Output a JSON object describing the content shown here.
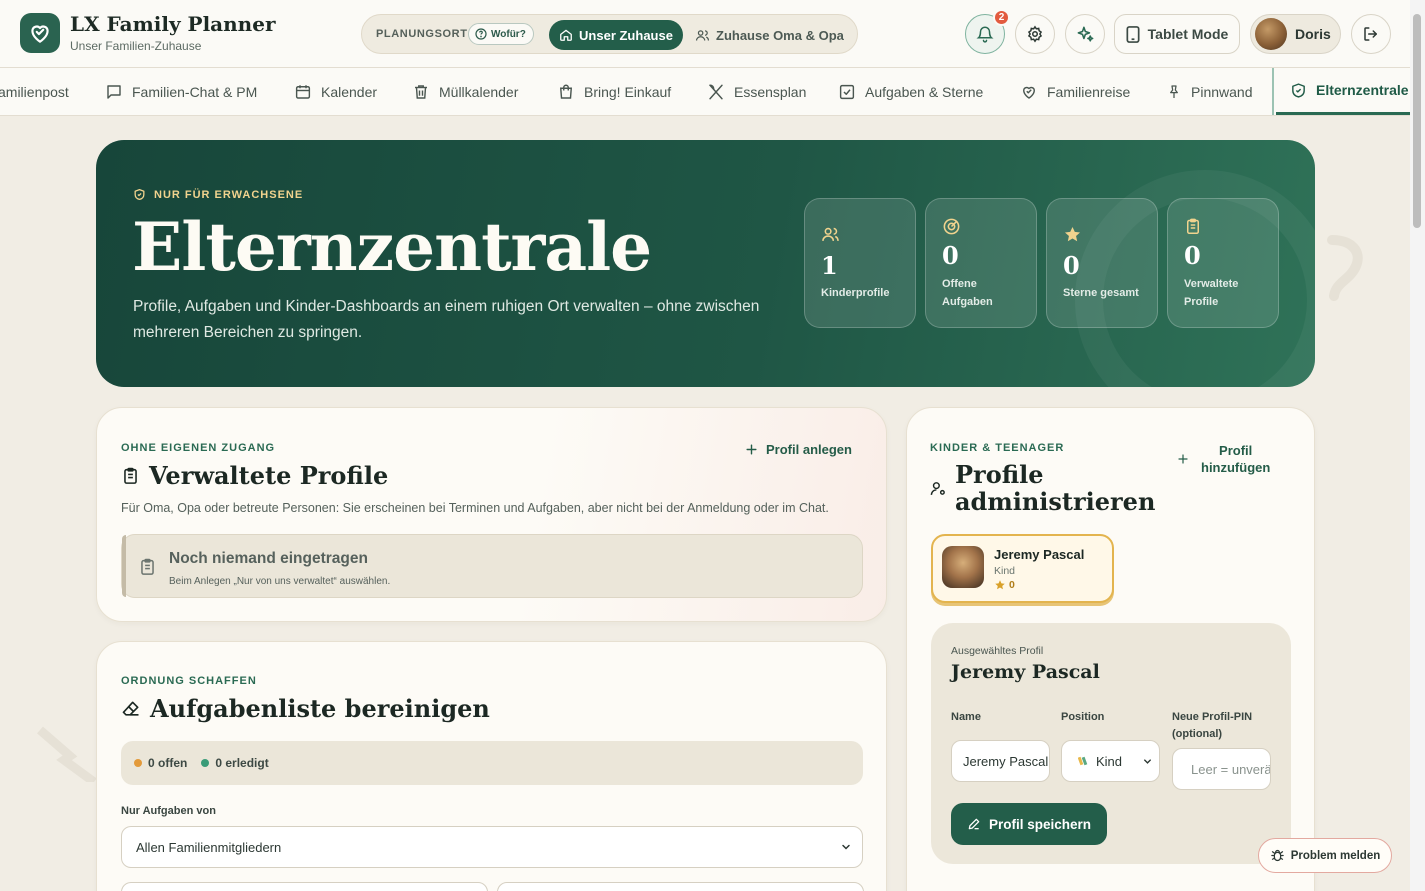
{
  "app": {
    "title": "LX Family Planner",
    "subtitle": "Unser Familien-Zuhause"
  },
  "planning": {
    "label": "PLANUNGSORT",
    "help": "Wofür?",
    "active": "Unser Zuhause",
    "inactive": "Zuhause Oma & Opa"
  },
  "header": {
    "notifications_count": "2",
    "tablet_mode": "Tablet Mode",
    "user_name": "Doris"
  },
  "nav": {
    "tabs": [
      {
        "label": "amilienpost",
        "icon": "mail-icon"
      },
      {
        "label": "Familien-Chat & PM",
        "icon": "chat-icon"
      },
      {
        "label": "Kalender",
        "icon": "calendar-icon"
      },
      {
        "label": "Müllkalender",
        "icon": "trash-icon"
      },
      {
        "label": "Bring! Einkauf",
        "icon": "shopping-bag-icon"
      },
      {
        "label": "Essensplan",
        "icon": "utensils-icon"
      },
      {
        "label": "Aufgaben & Sterne",
        "icon": "checkbox-icon"
      },
      {
        "label": "Familienreise",
        "icon": "heart-icon"
      },
      {
        "label": "Pinnwand",
        "icon": "pin-icon"
      },
      {
        "label": "Elternzentrale",
        "icon": "shield-icon"
      }
    ],
    "active_index": 9
  },
  "hero": {
    "kicker": "NUR FÜR ERWACHSENE",
    "title": "Elternzentrale",
    "description": "Profile, Aufgaben und Kinder-Dashboards an einem ruhigen Ort verwalten – ohne zwischen mehreren Bereichen zu springen.",
    "stats": [
      {
        "value": "1",
        "label": "Kinderprofile",
        "icon": "users-icon"
      },
      {
        "value": "0",
        "label": "Offene Aufgaben",
        "icon": "target-icon"
      },
      {
        "value": "0",
        "label": "Sterne gesamt",
        "icon": "star-icon"
      },
      {
        "value": "0",
        "label": "Verwaltete Profile",
        "icon": "clipboard-icon"
      }
    ]
  },
  "managed": {
    "kicker": "OHNE EIGENEN ZUGANG",
    "title": "Verwaltete Profile",
    "add_link": "Profil anlegen",
    "description": "Für Oma, Opa oder betreute Personen: Sie erscheinen bei Terminen und Aufgaben, aber nicht bei der Anmeldung oder im Chat.",
    "empty_title": "Noch niemand eingetragen",
    "empty_hint": "Beim Anlegen „Nur von uns verwaltet“ auswählen."
  },
  "cleanup": {
    "kicker": "ORDNUNG SCHAFFEN",
    "title": "Aufgabenliste bereinigen",
    "open_count": "0 offen",
    "done_count": "0 erledigt",
    "filter_label": "Nur Aufgaben von",
    "filter_value": "Allen Familienmitgliedern"
  },
  "kids": {
    "kicker": "KINDER & TEENAGER",
    "title_line1": "Profile",
    "title_line2": "administrieren",
    "add_link_line1": "Profil",
    "add_link_line2": "hinzufügen",
    "profile": {
      "name": "Jeremy Pascal",
      "role": "Kind",
      "stars": "0"
    },
    "selected_label": "Ausgewähltes Profil",
    "selected_name": "Jeremy Pascal",
    "fields": {
      "name_label": "Name",
      "name_value": "Jeremy Pascal",
      "position_label": "Position",
      "position_value": "Kind",
      "pin_label_line1": "Neue Profil-PIN",
      "pin_label_line2": "(optional)",
      "pin_placeholder": "Leer = unverändert"
    },
    "save_button": "Profil speichern"
  },
  "report_button": "Problem melden",
  "colors": {
    "primary": "#235e4a",
    "hero_dark": "#17463a",
    "accent_gold": "#f1d38e",
    "badge_red": "#e25b3f",
    "star_gold": "#d9a12a"
  }
}
